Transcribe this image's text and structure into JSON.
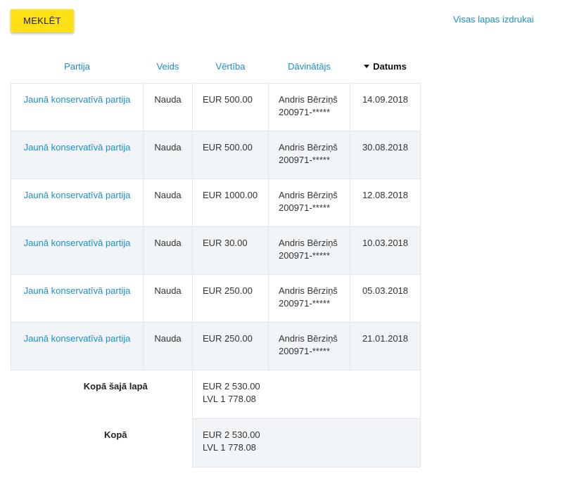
{
  "toolbar": {
    "search_label": "MEKLĒT",
    "print_label": "Visas lapas izdrukai"
  },
  "table": {
    "columns": [
      {
        "label": "Partija"
      },
      {
        "label": "Veids"
      },
      {
        "label": "Vērtība"
      },
      {
        "label": "Dāvinātājs"
      },
      {
        "label": "Datums",
        "sorted": "desc"
      }
    ],
    "rows": [
      {
        "party": "Jaunā konservatīvā partija",
        "type": "Nauda",
        "value": "EUR 500.00",
        "donor_name": "Andris Bērziņš",
        "donor_id": "200971-*****",
        "date": "14.09.2018"
      },
      {
        "party": "Jaunā konservatīvā partija",
        "type": "Nauda",
        "value": "EUR 500.00",
        "donor_name": "Andris Bērziņš",
        "donor_id": "200971-*****",
        "date": "30.08.2018"
      },
      {
        "party": "Jaunā konservatīvā partija",
        "type": "Nauda",
        "value": "EUR 1000.00",
        "donor_name": "Andris Bērziņš",
        "donor_id": "200971-*****",
        "date": "12.08.2018"
      },
      {
        "party": "Jaunā konservatīvā partija",
        "type": "Nauda",
        "value": "EUR 30.00",
        "donor_name": "Andris Bērziņš",
        "donor_id": "200971-*****",
        "date": "10.03.2018"
      },
      {
        "party": "Jaunā konservatīvā partija",
        "type": "Nauda",
        "value": "EUR 250.00",
        "donor_name": "Andris Bērziņš",
        "donor_id": "200971-*****",
        "date": "05.03.2018"
      },
      {
        "party": "Jaunā konservatīvā partija",
        "type": "Nauda",
        "value": "EUR 250.00",
        "donor_name": "Andris Bērziņš",
        "donor_id": "200971-*****",
        "date": "21.01.2018"
      }
    ],
    "totals": [
      {
        "label": "Kopā šajā lapā",
        "eur": "EUR 2 530.00",
        "lvl": "LVL 1 778.08"
      },
      {
        "label": "Kopā",
        "eur": "EUR 2 530.00",
        "lvl": "LVL 1 778.08"
      }
    ]
  },
  "colors": {
    "accent_yellow": "#ffe014",
    "link_blue": "#1a8fc8",
    "row_alt": "#f2f5f8"
  }
}
